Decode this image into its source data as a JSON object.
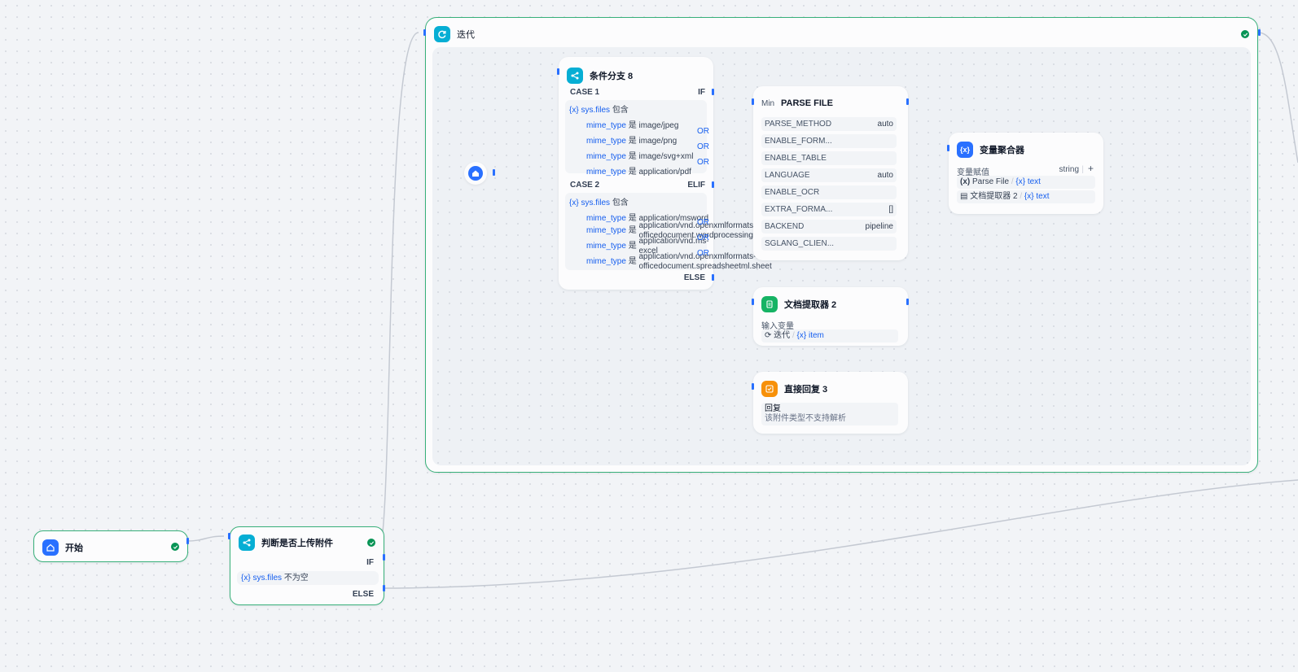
{
  "colors": {
    "accent_blue": "#2970ff",
    "cyan_node": "#06aed4",
    "green_node": "#16b364",
    "orange_node": "#f79009",
    "success": "#079455",
    "iteration_border": "#38b07a",
    "edge": "#c4c9d2"
  },
  "start_node": {
    "title": "开始",
    "icon": "home-icon"
  },
  "check_node": {
    "title": "判断是否上传附件",
    "icon": "branch-icon",
    "if_label": "IF",
    "else_label": "ELSE",
    "condition_var": "sys.files",
    "condition_op": "不为空"
  },
  "iteration_node": {
    "title": "迭代",
    "icon": "loop-icon"
  },
  "iteration_start": {
    "icon": "home-icon"
  },
  "branch_node": {
    "title": "条件分支 8",
    "icon": "branch-icon",
    "case1": {
      "label": "CASE 1",
      "port": "IF",
      "var": "sys.files",
      "op": "包含",
      "rows": [
        {
          "field": "mime_type",
          "op": "是",
          "value": "image/jpeg"
        },
        {
          "field": "mime_type",
          "op": "是",
          "value": "image/png"
        },
        {
          "field": "mime_type",
          "op": "是",
          "value": "image/svg+xml"
        },
        {
          "field": "mime_type",
          "op": "是",
          "value": "application/pdf"
        }
      ],
      "or": [
        "OR",
        "OR",
        "OR"
      ]
    },
    "case2": {
      "label": "CASE 2",
      "port": "ELIF",
      "var": "sys.files",
      "op": "包含",
      "rows": [
        {
          "field": "mime_type",
          "op": "是",
          "value": "application/msword"
        },
        {
          "field": "mime_type",
          "op": "是",
          "value": "application/vnd.openxmlformats-",
          "value2": "officedocument.wordprocessingml"
        },
        {
          "field": "mime_type",
          "op": "是",
          "value": "application/vnd.ms-",
          "value2": "excel"
        },
        {
          "field": "mime_type",
          "op": "是",
          "value": "application/vnd.openxmlformats-",
          "value2": "officedocument.spreadsheetml.sheet"
        }
      ],
      "or": [
        "OR",
        "OR",
        "OR"
      ]
    },
    "else_label": "ELSE"
  },
  "parse_node": {
    "prefix": "Min",
    "title": "PARSE FILE",
    "params": [
      {
        "key": "PARSE_METHOD",
        "value": "auto"
      },
      {
        "key": "ENABLE_FORM...",
        "value": ""
      },
      {
        "key": "ENABLE_TABLE",
        "value": ""
      },
      {
        "key": "LANGUAGE",
        "value": "auto"
      },
      {
        "key": "ENABLE_OCR",
        "value": ""
      },
      {
        "key": "EXTRA_FORMA...",
        "value": "[]"
      },
      {
        "key": "BACKEND",
        "value": "pipeline"
      },
      {
        "key": "SGLANG_CLIEN...",
        "value": ""
      }
    ]
  },
  "extractor_node": {
    "title": "文档提取器 2",
    "icon": "document-icon",
    "input_label": "输入变量",
    "input_source": "迭代",
    "input_var": "item"
  },
  "reply_node": {
    "title": "直接回复 3",
    "icon": "reply-icon",
    "label": "回复",
    "text": "该附件类型不支持解析"
  },
  "aggregator_node": {
    "title": "变量聚合器",
    "icon": "variable-icon",
    "value_label": "变量赋值",
    "type": "string",
    "add": "+",
    "items": [
      {
        "source": "Parse File",
        "var": "text"
      },
      {
        "source": "文档提取器 2",
        "var": "text"
      }
    ]
  }
}
